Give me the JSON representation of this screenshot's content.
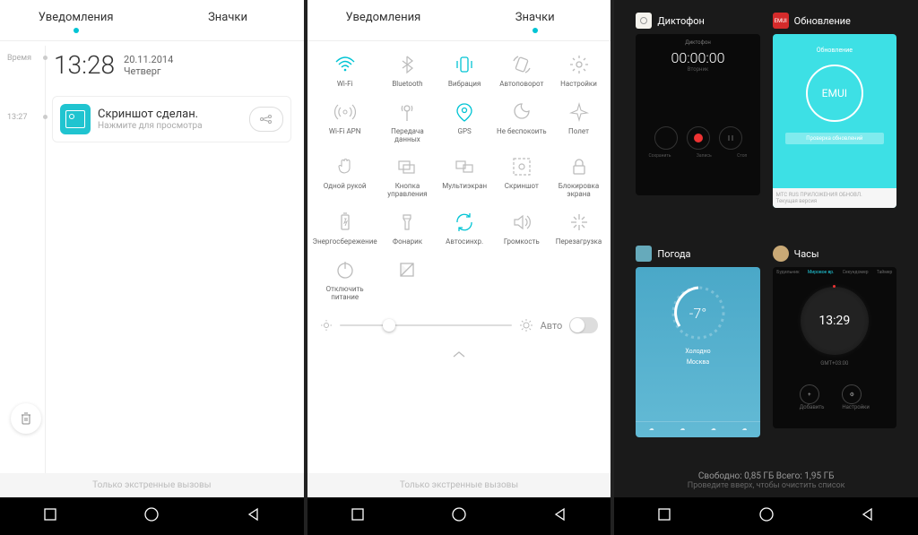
{
  "screen1": {
    "tabs": {
      "notifications": "Уведомления",
      "icons": "Значки"
    },
    "timeLabel": "Время",
    "time": "13:28",
    "date": "20.11.2014",
    "day": "Четверг",
    "notificationTime": "13:27",
    "notification": {
      "title": "Скриншот сделан.",
      "subtitle": "Нажмите для просмотра"
    },
    "footer": "Только экстренные вызовы"
  },
  "screen2": {
    "tabs": {
      "notifications": "Уведомления",
      "icons": "Значки"
    },
    "toggles": [
      {
        "id": "wifi",
        "label": "Wi-Fi",
        "on": true
      },
      {
        "id": "bluetooth",
        "label": "Bluetooth",
        "on": false
      },
      {
        "id": "vibrate",
        "label": "Вибрация",
        "on": true
      },
      {
        "id": "autorotate",
        "label": "Автоповорот",
        "on": false
      },
      {
        "id": "settings",
        "label": "Настройки",
        "on": false
      },
      {
        "id": "wifi-apn",
        "label": "Wi-Fi APN",
        "on": false
      },
      {
        "id": "data",
        "label": "Передача данных",
        "on": false
      },
      {
        "id": "gps",
        "label": "GPS",
        "on": true
      },
      {
        "id": "dnd",
        "label": "Не беспокоить",
        "on": false
      },
      {
        "id": "airplane",
        "label": "Полет",
        "on": false
      },
      {
        "id": "onehand",
        "label": "Одной рукой",
        "on": false
      },
      {
        "id": "control",
        "label": "Кнопка управления",
        "on": false
      },
      {
        "id": "multiscreen",
        "label": "Мультиэкран",
        "on": false
      },
      {
        "id": "screenshot",
        "label": "Скриншот",
        "on": false
      },
      {
        "id": "lock",
        "label": "Блокировка экрана",
        "on": false
      },
      {
        "id": "powersave",
        "label": "Энергосбережение",
        "on": false
      },
      {
        "id": "torch",
        "label": "Фонарик",
        "on": false
      },
      {
        "id": "autosync",
        "label": "Автосинхр.",
        "on": true
      },
      {
        "id": "volume",
        "label": "Громкость",
        "on": false
      },
      {
        "id": "reboot",
        "label": "Перезагрузка",
        "on": false
      },
      {
        "id": "poweroff",
        "label": "Отключить питание",
        "on": false
      },
      {
        "id": "theme",
        "label": "",
        "on": false
      }
    ],
    "auto": "Авто",
    "footer": "Только экстренные вызовы"
  },
  "screen3": {
    "apps": {
      "dictaphone": {
        "name": "Диктофон",
        "label": "Диктофон",
        "timer": "00:00:00",
        "day": "Вторник",
        "ctl": [
          "Сохранить",
          "Запись",
          "Стоп"
        ]
      },
      "update": {
        "name": "Обновление",
        "label": "Обновление",
        "brand": "EMUI",
        "msg": "Проверка обновлений",
        "foot1": "МТС RUS ПРИЛОЖЕНИЯ ОБНОВЛ.",
        "foot2": "Текущая версия"
      },
      "weather": {
        "name": "Погода",
        "temp": "-7°",
        "cond": "Холодно",
        "city": "Москва"
      },
      "clock": {
        "name": "Часы",
        "time": "13:29",
        "tz": "GMT+03:00",
        "tabs": [
          "Будильник",
          "Мировое вр.",
          "Секундомер",
          "Таймер"
        ],
        "add": "Добавить",
        "settings": "Настройки"
      }
    },
    "memory": {
      "line1": "Свободно: 0,85 ГБ Всего: 1,95 ГБ",
      "line2": "Проведите вверх, чтобы очистить список"
    }
  }
}
